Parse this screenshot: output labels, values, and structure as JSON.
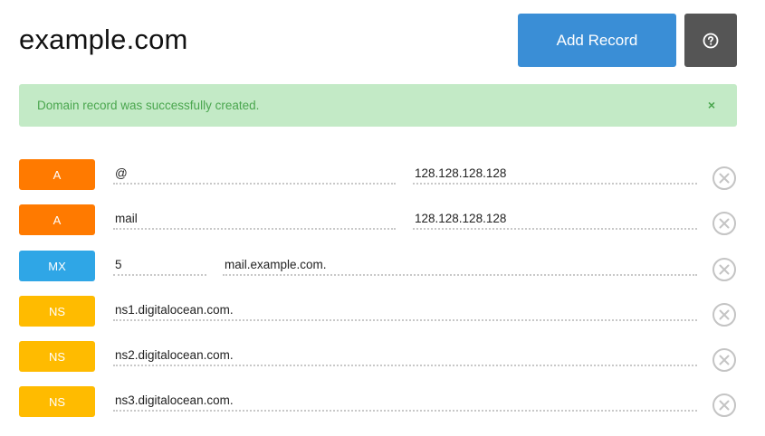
{
  "header": {
    "domain": "example.com",
    "add_record_label": "Add Record"
  },
  "alert": {
    "message": "Domain record was successfully created.",
    "close_symbol": "×"
  },
  "colors": {
    "A": "#ff7a00",
    "MX": "#2fa6e6",
    "NS": "#ffbb00",
    "add_button": "#3a8ed6",
    "help_button": "#555555",
    "alert_bg": "#c3eac6",
    "alert_text": "#4aa64e"
  },
  "icons": {
    "help": "question-circle-icon",
    "delete": "close-circle-icon",
    "dismiss": "close-icon"
  },
  "records": [
    {
      "type": "A",
      "name": "@",
      "value": "128.128.128.128"
    },
    {
      "type": "A",
      "name": "mail",
      "value": "128.128.128.128"
    },
    {
      "type": "MX",
      "priority": "5",
      "value": "mail.example.com."
    },
    {
      "type": "NS",
      "value": "ns1.digitalocean.com."
    },
    {
      "type": "NS",
      "value": "ns2.digitalocean.com."
    },
    {
      "type": "NS",
      "value": "ns3.digitalocean.com."
    }
  ]
}
